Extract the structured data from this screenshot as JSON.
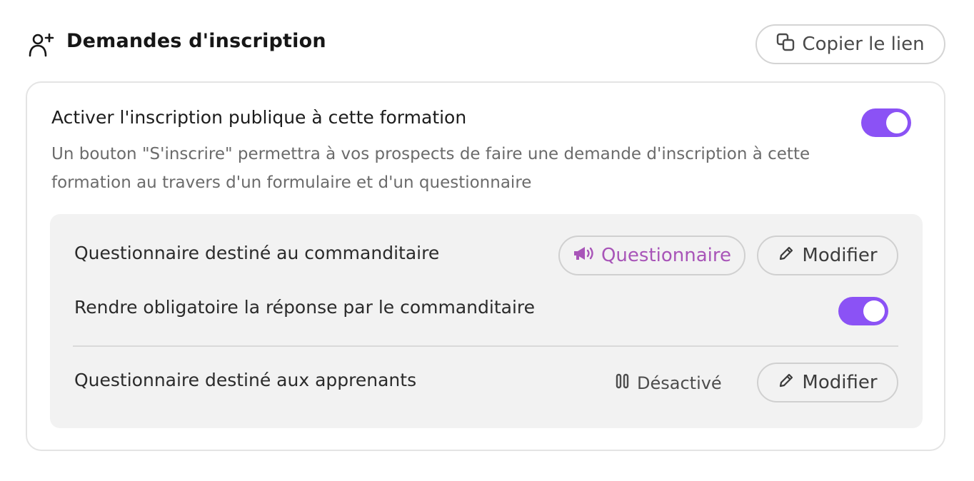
{
  "header": {
    "title": "Demandes d'inscription",
    "icon": "user-plus-icon",
    "copy_button": {
      "label": "Copier le lien",
      "icon": "copy-icon"
    }
  },
  "card": {
    "title": "Activer l'inscription publique à cette formation",
    "description": "Un bouton \"S'inscrire\" permettra à vos prospects de faire une demande d'inscription à cette formation au travers d'un formulaire et d'un questionnaire",
    "public_toggle_on": true,
    "inner": {
      "sponsor_questionnaire": {
        "label": "Questionnaire destiné au commanditaire",
        "questionnaire_button": {
          "label": "Questionnaire",
          "icon": "megaphone-icon",
          "color": "#a855b8"
        },
        "edit_button": {
          "label": "Modifier",
          "icon": "pencil-icon"
        }
      },
      "sponsor_required": {
        "label": "Rendre obligatoire la réponse par le commanditaire",
        "toggle_on": true
      },
      "learners_questionnaire": {
        "label": "Questionnaire destiné aux apprenants",
        "status": {
          "label": "Désactivé",
          "icon": "pause-icon"
        },
        "edit_button": {
          "label": "Modifier",
          "icon": "pencil-icon"
        }
      }
    }
  },
  "colors": {
    "accent": "#8b52f5",
    "questionnaire": "#a855b8",
    "panel": "#f2f2f2"
  }
}
